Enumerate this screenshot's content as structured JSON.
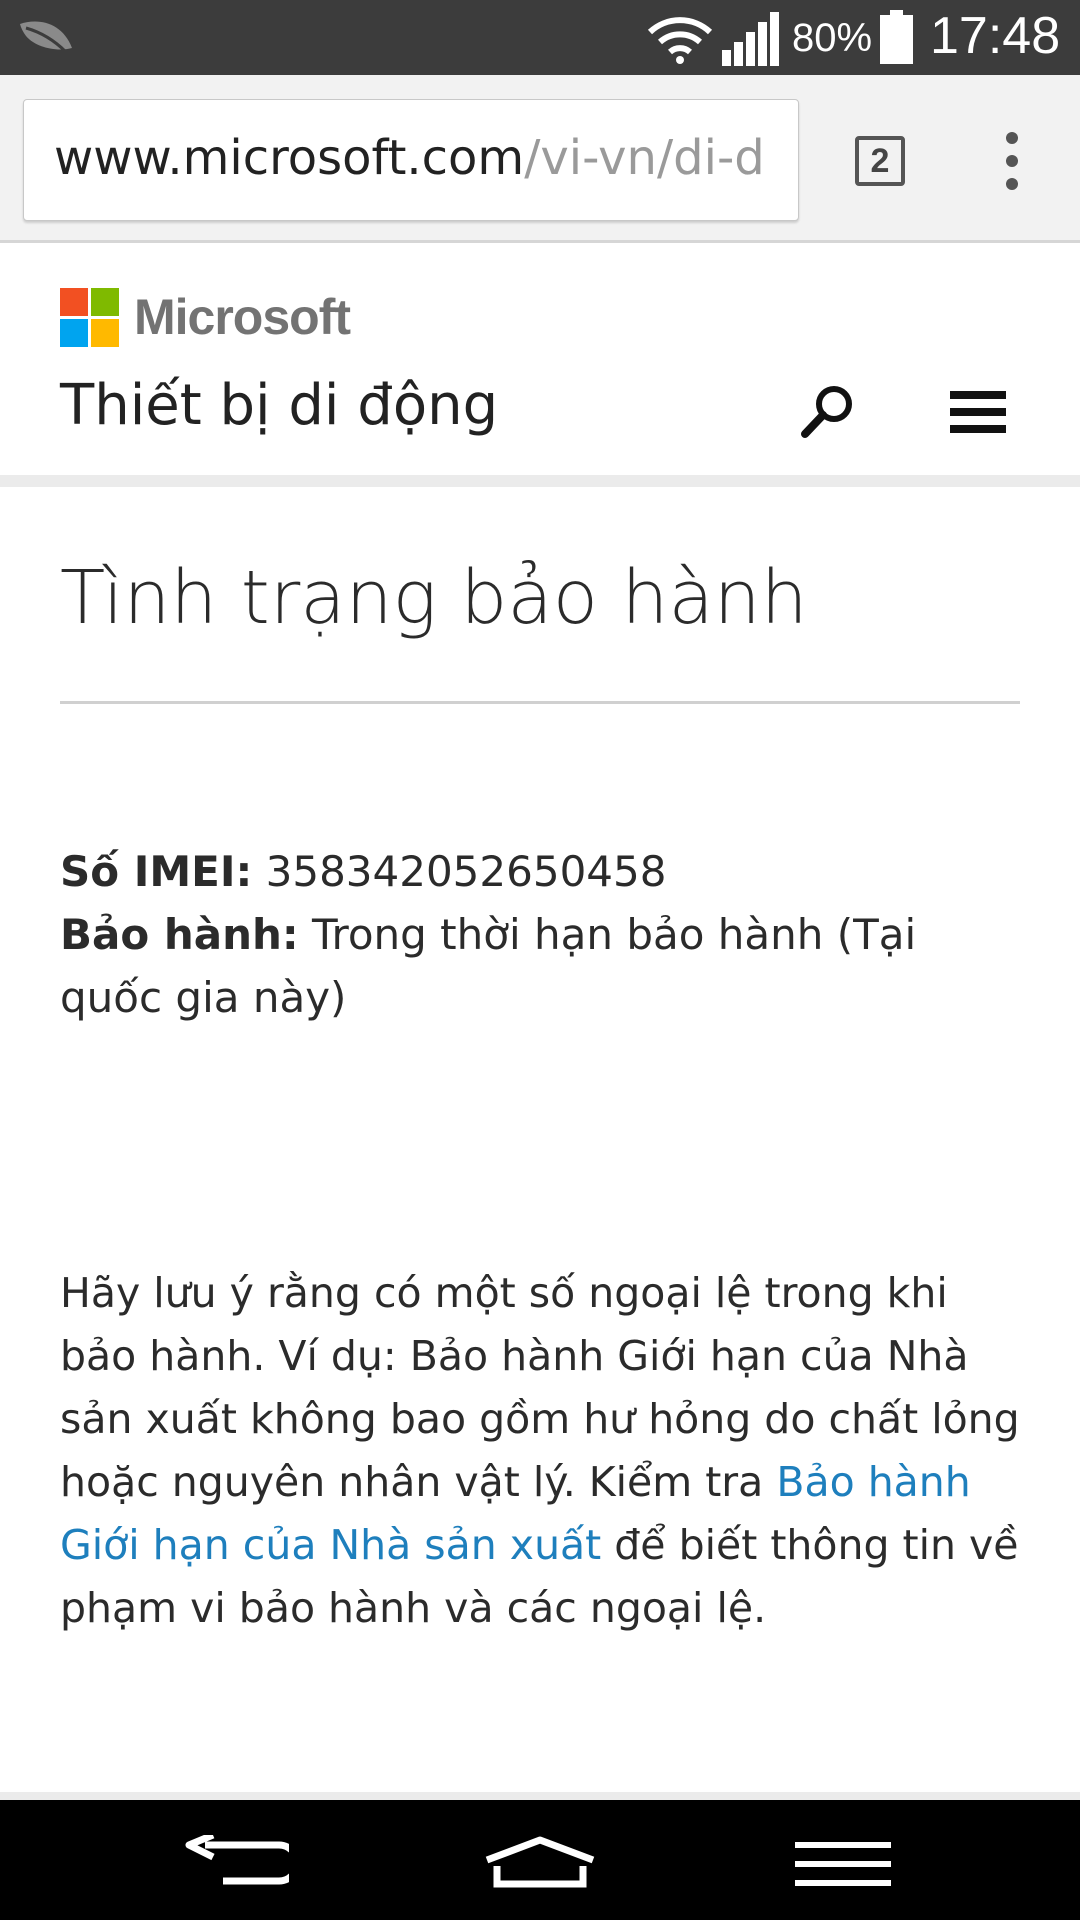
{
  "status_bar": {
    "battery_percent": "80%",
    "time": "17:48",
    "icons": [
      "leaf-icon",
      "wifi-icon",
      "signal-icon",
      "battery-icon"
    ]
  },
  "browser": {
    "url_host": "www.microsoft.com",
    "url_path": "/vi-vn/di-d",
    "tab_count": "2"
  },
  "header": {
    "brand": "Microsoft",
    "section_title": "Thiết bị di động",
    "logo_colors": [
      "#f25022",
      "#7fba00",
      "#00a4ef",
      "#ffb900"
    ]
  },
  "main": {
    "title": "Tình trạng bảo hành",
    "imei_label": "Số IMEI:",
    "imei_value": "358342052650458",
    "warranty_label": "Bảo hành:",
    "warranty_value": "Trong thời hạn bảo hành (Tại quốc gia này)",
    "note_text_1": "Hãy lưu ý rằng có một số ngoại lệ trong khi bảo hành. Ví dụ: Bảo hành Giới hạn của Nhà sản xuất không bao gồm hư hỏng do chất lỏng hoặc nguyên nhân vật lý. Kiểm tra ",
    "note_link": "Bảo hành Giới hạn của Nhà sản xuất",
    "note_text_2": " để biết thông tin về phạm vi bảo hành và các ngoại lệ.",
    "link_color": "#1e7fbd"
  }
}
